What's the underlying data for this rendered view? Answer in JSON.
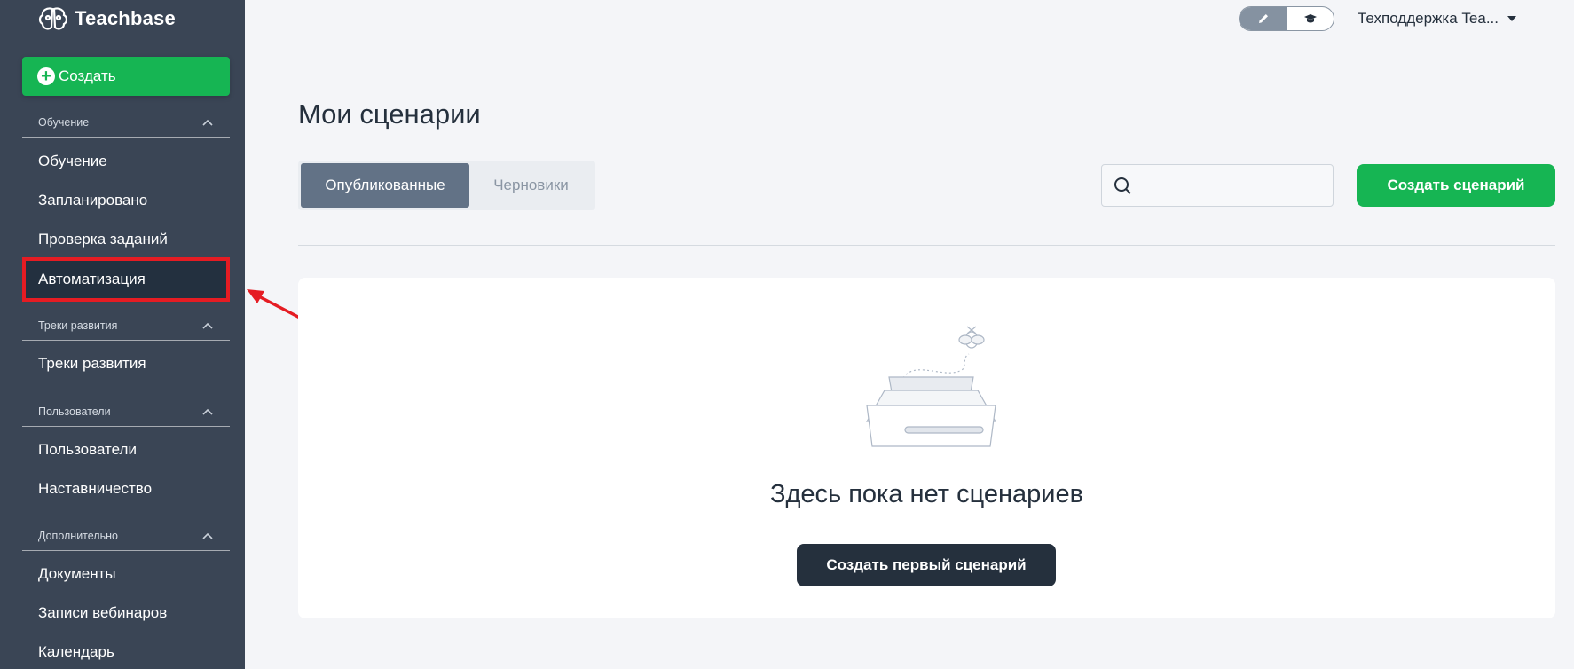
{
  "app": {
    "brand": "Teachbase"
  },
  "sidebar": {
    "create_label": "Создать",
    "sections": [
      {
        "title": "Обучение",
        "items": [
          "Обучение",
          "Запланировано",
          "Проверка заданий",
          "Автоматизация"
        ]
      },
      {
        "title": "Треки развития",
        "items": [
          "Треки развития"
        ]
      },
      {
        "title": "Пользователи",
        "items": [
          "Пользователи",
          "Наставничество"
        ]
      },
      {
        "title": "Дополнительно",
        "items": [
          "Документы",
          "Записи вебинаров",
          "Календарь"
        ]
      }
    ],
    "active_item": "Автоматизация"
  },
  "topbar": {
    "mode_active": "edit",
    "modes": [
      "pencil-icon",
      "graduation-cap-icon"
    ],
    "user_label": "Техподдержка Tea..."
  },
  "main": {
    "title": "Мои сценарии",
    "tabs": [
      {
        "label": "Опубликованные",
        "active": true
      },
      {
        "label": "Черновики",
        "active": false
      }
    ],
    "search": {
      "placeholder": ""
    },
    "create_button": "Создать сценарий",
    "empty_state": {
      "message": "Здесь пока нет сценариев",
      "button": "Создать первый сценарий"
    }
  },
  "colors": {
    "sidebar_bg": "#3a4555",
    "accent_green": "#16b553",
    "dark_button": "#25303d",
    "highlight_red": "#e51c23"
  }
}
